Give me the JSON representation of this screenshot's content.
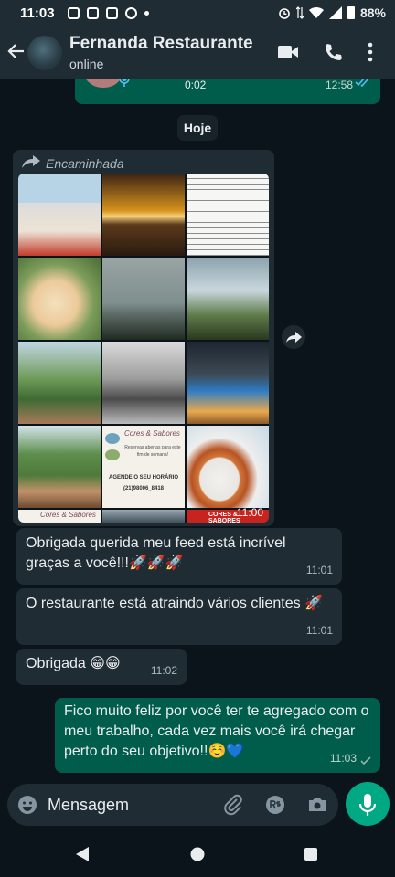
{
  "status_bar": {
    "time": "11:03",
    "battery": "88%"
  },
  "header": {
    "contact_name": "Fernanda Restaurante",
    "status": "online"
  },
  "voice_message": {
    "duration": "0:02",
    "time": "12:58"
  },
  "date_chip": "Hoje",
  "forwarded": {
    "label": "Encaminhada",
    "time": "11:00",
    "image_texts": {
      "flyer_brand": "Cores & Sabores",
      "flyer_line": "Reservas abertas para este fim de semana!",
      "flyer_cta": "AGENDE O SEU HORÁRIO",
      "flyer_phone": "(21)98006_8418",
      "banner": "CORES & SABORES"
    }
  },
  "messages": [
    {
      "text": "Obrigada querida meu feed está incrível graças a você!!!🚀🚀🚀",
      "time": "11:01"
    },
    {
      "text": "O restaurante está atraindo vários clientes 🚀",
      "time": "11:01"
    },
    {
      "text": "Obrigada 😁😁",
      "time": "11:02"
    },
    {
      "text": "Fico muito feliz por você ter te agregado com o meu trabalho, cada vez mais você irá chegar perto do seu objetivo!!☺️💙",
      "time": "11:03"
    }
  ],
  "input": {
    "placeholder": "Mensagem"
  },
  "colors": {
    "outgoing": "#005c4b",
    "incoming": "#202c33",
    "accent": "#00a884",
    "background": "#0b141a"
  }
}
